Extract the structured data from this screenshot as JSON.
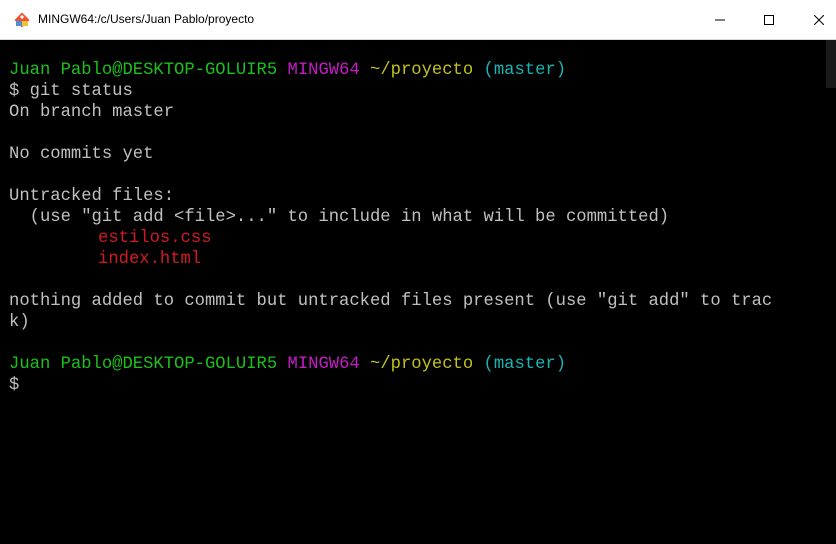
{
  "window": {
    "title": "MINGW64:/c/Users/Juan Pablo/proyecto",
    "icon": "git-bash-icon",
    "controls": {
      "minimize": "minimize-icon",
      "maximize": "maximize-icon",
      "close": "close-icon"
    }
  },
  "colors": {
    "user_host": "#1cc01c",
    "system": "#c51dc5",
    "path": "#c2c21d",
    "branch": "#1bb3b3",
    "untracked": "#d11b23",
    "text": "#bfbfbf"
  },
  "terminal": {
    "prompt1": {
      "user_host": "Juan Pablo@DESKTOP-GOLUIR5",
      "system": "MINGW64",
      "path": "~/proyecto",
      "branch": "(master)"
    },
    "command": "$ git status",
    "output": {
      "branch_line": "On branch master",
      "commits_line": "No commits yet",
      "untracked_header": "Untracked files:",
      "hint": "  (use \"git add <file>...\" to include in what will be committed)",
      "files": [
        "estilos.css",
        "index.html"
      ],
      "summary_part1": "nothing added to commit but untracked files present (use \"git add\" to trac",
      "summary_part2": "k)"
    },
    "prompt2": {
      "user_host": "Juan Pablo@DESKTOP-GOLUIR5",
      "system": "MINGW64",
      "path": "~/proyecto",
      "branch": "(master)"
    },
    "cursor_prompt": "$"
  }
}
